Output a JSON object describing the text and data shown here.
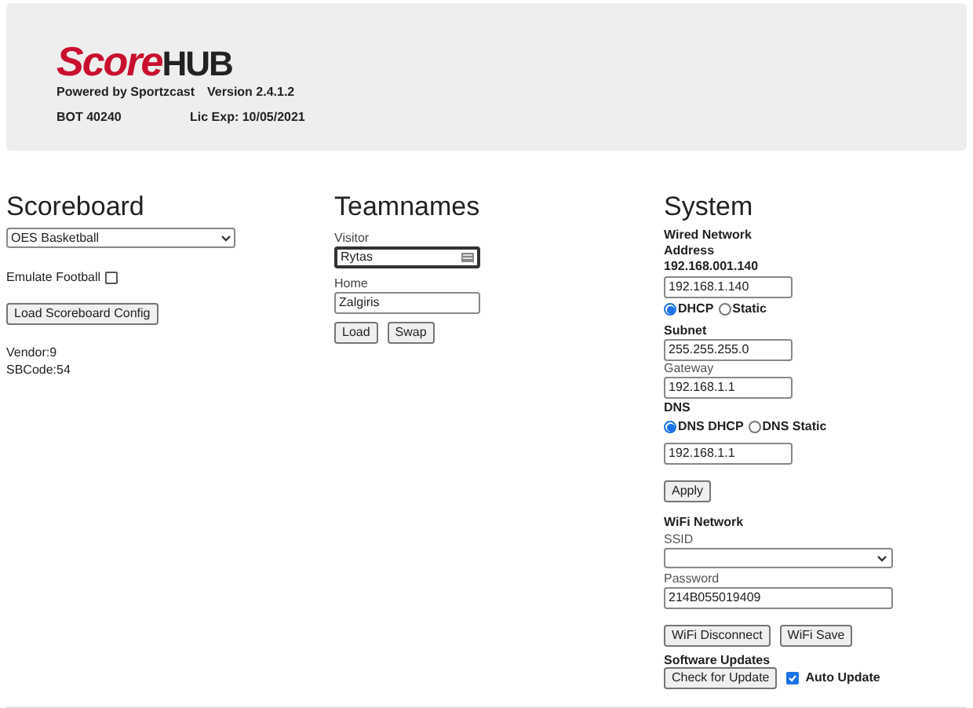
{
  "header": {
    "logo": {
      "part_1": "Score",
      "part_2": "HUB"
    },
    "powered_by": "Powered by Sportzcast",
    "version": "Version 2.4.1.2",
    "bot": "BOT 40240",
    "lic_exp": "Lic Exp: 10/05/2021"
  },
  "scoreboard": {
    "title": "Scoreboard",
    "select_value": "OES Basketball",
    "emulate_football": {
      "label": "Emulate Football",
      "checked": false
    },
    "load_button": "Load Scoreboard Config",
    "vendor": "Vendor:9",
    "sbcode": "SBCode:54"
  },
  "teamnames": {
    "title": "Teamnames",
    "visitor": {
      "label": "Visitor",
      "value": "Rytas",
      "focused": true
    },
    "home": {
      "label": "Home",
      "value": "Zalgiris",
      "focused": false
    },
    "buttons": [
      "Load",
      "Swap"
    ]
  },
  "system": {
    "title": "System",
    "wired_network": "Wired Network",
    "address_label": "Address",
    "address_current": "192.168.001.140",
    "address_value": "192.168.1.140",
    "address_modes": [
      {
        "label": "DHCP",
        "selected": true
      },
      {
        "label": "Static",
        "selected": false
      }
    ],
    "subnet_label": "Subnet",
    "subnet_value": "255.255.255.0",
    "gateway_label": "Gateway",
    "gateway_value": "192.168.1.1",
    "dns_label": "DNS",
    "dns_modes": [
      {
        "label": "DNS DHCP",
        "selected": true
      },
      {
        "label": "DNS Static",
        "selected": false
      }
    ],
    "dns_value": "192.168.1.1",
    "apply_button": "Apply",
    "wifi_network": "WiFi Network",
    "ssid_label": "SSID",
    "password_label": "Password",
    "password_value": "214B055019409",
    "wifi_buttons": [
      "WiFi Disconnect",
      "WiFi Save"
    ],
    "software_updates": "Software Updates",
    "check_button": "Check for Update",
    "auto_update": {
      "label": "Auto Update",
      "checked": true
    }
  }
}
